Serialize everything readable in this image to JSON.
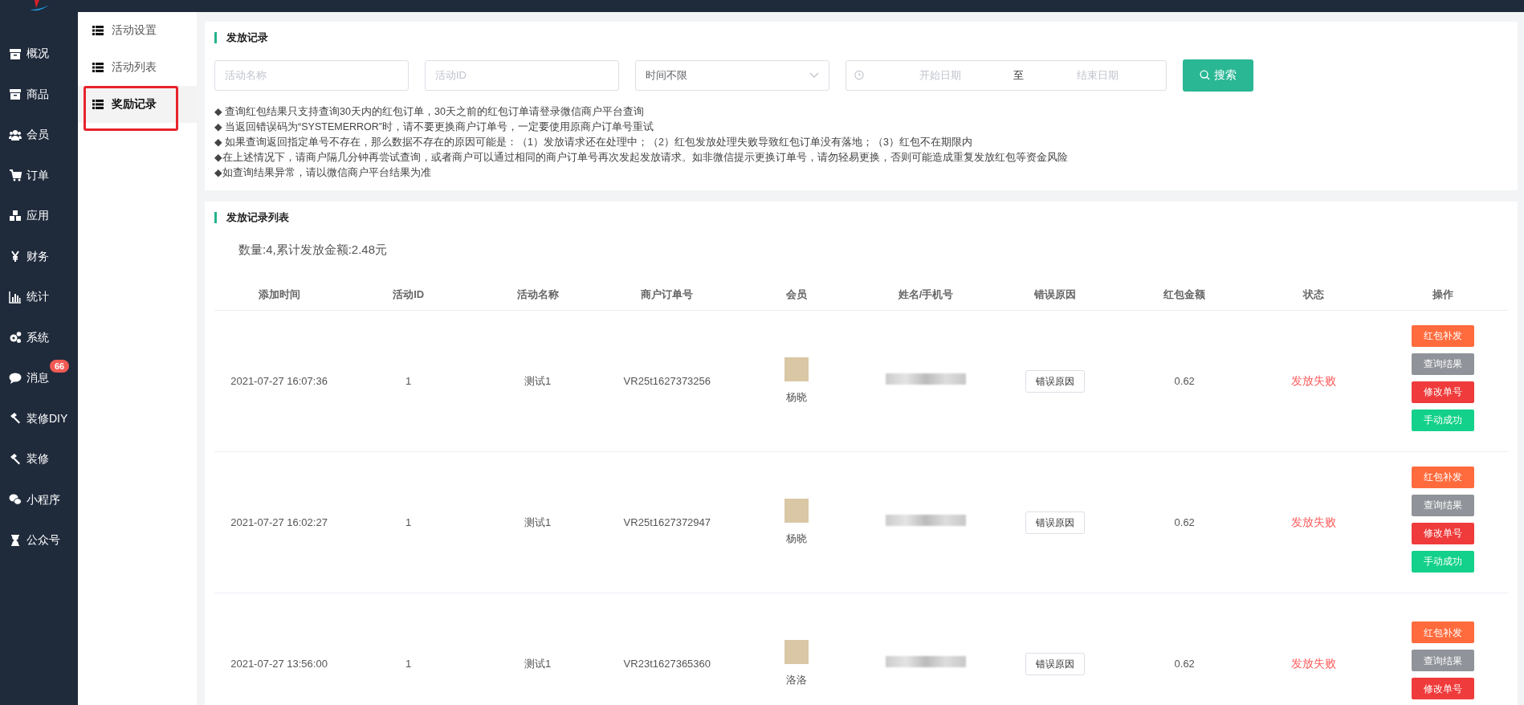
{
  "sidebar": {
    "items": [
      {
        "label": "概况"
      },
      {
        "label": "商品"
      },
      {
        "label": "会员"
      },
      {
        "label": "订单"
      },
      {
        "label": "应用"
      },
      {
        "label": "财务"
      },
      {
        "label": "统计"
      },
      {
        "label": "系统"
      },
      {
        "label": "消息",
        "badge": "66"
      },
      {
        "label": "装修DIY"
      },
      {
        "label": "装修"
      },
      {
        "label": "小程序"
      },
      {
        "label": "公众号"
      }
    ]
  },
  "submenu": {
    "items": [
      {
        "label": "活动设置",
        "selected": false,
        "marked": false
      },
      {
        "label": "活动列表",
        "selected": false,
        "marked": false
      },
      {
        "label": "奖励记录",
        "selected": true,
        "marked": true
      }
    ]
  },
  "filter_panel": {
    "title": "发放记录",
    "fields": [
      {
        "kind": "input",
        "placeholder": "活动名称"
      },
      {
        "kind": "input",
        "placeholder": "活动ID"
      },
      {
        "kind": "select",
        "value": "时间不限"
      }
    ],
    "date_range": {
      "start_placeholder": "开始日期",
      "separator": "至",
      "end_placeholder": "结束日期"
    },
    "search_button": "搜索",
    "notes": [
      "◆ 查询红包结果只支持查询30天内的红包订单，30天之前的红包订单请登录微信商户平台查询",
      "◆ 当返回错误码为“SYSTEMERROR”时，请不要更换商户订单号，一定要使用原商户订单号重试",
      "◆ 如果查询返回指定单号不存在，那么数据不存在的原因可能是：（1）发放请求还在处理中；（2）红包发放处理失败导致红包订单没有落地；（3）红包不在期限内",
      "◆在上述情况下，请商户隔几分钟再尝试查询，或者商户可以通过相同的商户订单号再次发起发放请求。如非微信提示更换订单号，请勿轻易更换，否则可能造成重复发放红包等资金风险",
      "◆如查询结果异常，请以微信商户平台结果为准"
    ]
  },
  "table_panel": {
    "title": "发放记录列表",
    "summary": "数量:4,累计发放金额:2.48元",
    "columns": [
      "添加时间",
      "活动ID",
      "活动名称",
      "商户订单号",
      "会员",
      "姓名/手机号",
      "错误原因",
      "红包金额",
      "状态",
      "操作"
    ],
    "rows": [
      {
        "time": "2021-07-27 16:07:36",
        "activity_id": "1",
        "activity_name": "测试1",
        "order_no": "VR25t1627373256",
        "member": "杨晓",
        "error_button": "错误原因",
        "amount": "0.62",
        "status": "发放失败",
        "actions": [
          {
            "label": "红包补发",
            "kind": "warning"
          },
          {
            "label": "查询结果",
            "kind": "info"
          },
          {
            "label": "修改单号",
            "kind": "danger"
          },
          {
            "label": "手动成功",
            "kind": "success"
          }
        ]
      },
      {
        "time": "2021-07-27 16:02:27",
        "activity_id": "1",
        "activity_name": "测试1",
        "order_no": "VR25t1627372947",
        "member": "杨晓",
        "error_button": "错误原因",
        "amount": "0.62",
        "status": "发放失败",
        "actions": [
          {
            "label": "红包补发",
            "kind": "warning"
          },
          {
            "label": "查询结果",
            "kind": "info"
          },
          {
            "label": "修改单号",
            "kind": "danger"
          },
          {
            "label": "手动成功",
            "kind": "success"
          }
        ]
      },
      {
        "time": "2021-07-27 13:56:00",
        "activity_id": "1",
        "activity_name": "测试1",
        "order_no": "VR23t1627365360",
        "member": "洛洛",
        "error_button": "错误原因",
        "amount": "0.62",
        "status": "发放失败",
        "actions": [
          {
            "label": "红包补发",
            "kind": "warning"
          },
          {
            "label": "查询结果",
            "kind": "info"
          },
          {
            "label": "修改单号",
            "kind": "danger"
          }
        ]
      }
    ]
  }
}
